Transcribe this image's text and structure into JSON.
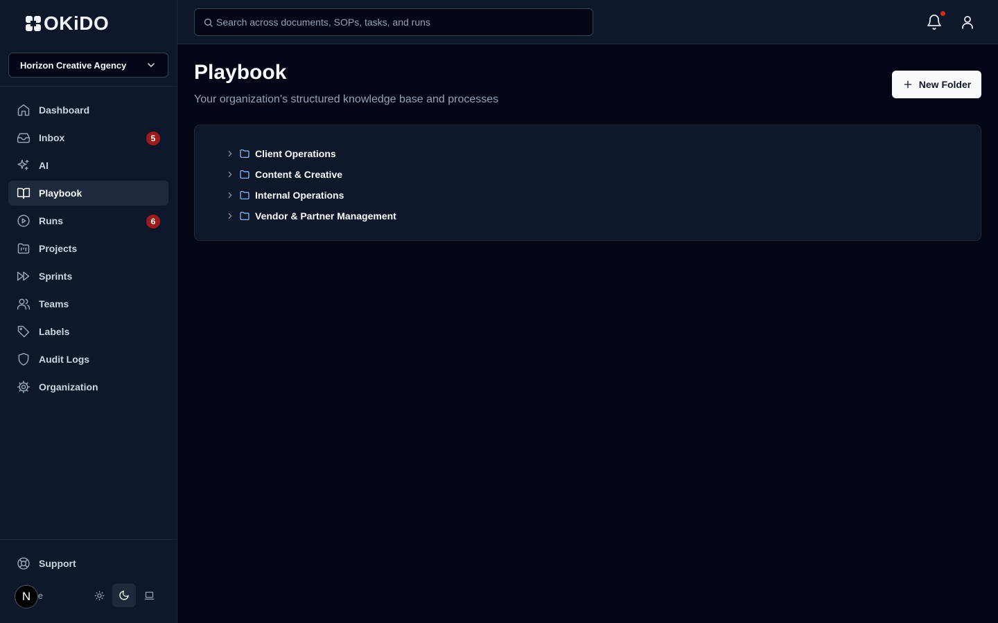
{
  "brand": {
    "name": "OKiDO"
  },
  "org_selector": {
    "value": "Horizon Creative Agency"
  },
  "nav": [
    {
      "label": "Dashboard",
      "icon": "home-icon",
      "active": false
    },
    {
      "label": "Inbox",
      "icon": "inbox-icon",
      "badge": "5",
      "active": false
    },
    {
      "label": "AI",
      "icon": "sparkles-icon",
      "active": false
    },
    {
      "label": "Playbook",
      "icon": "book-open-icon",
      "active": true
    },
    {
      "label": "Runs",
      "icon": "play-circle-icon",
      "badge": "6",
      "active": false
    },
    {
      "label": "Projects",
      "icon": "folder-kanban-icon",
      "active": false
    },
    {
      "label": "Sprints",
      "icon": "fast-forward-icon",
      "active": false
    },
    {
      "label": "Teams",
      "icon": "users-icon",
      "active": false
    },
    {
      "label": "Labels",
      "icon": "tag-icon",
      "active": false
    },
    {
      "label": "Audit Logs",
      "icon": "shield-icon",
      "active": false
    },
    {
      "label": "Organization",
      "icon": "gear-icon",
      "active": false
    }
  ],
  "footer": {
    "support_label": "Support",
    "avatar_initial": "N",
    "user_name_fragment": "e",
    "theme_active": "dark"
  },
  "search": {
    "placeholder": "Search across documents, SOPs, tasks, and runs",
    "value": ""
  },
  "page": {
    "title": "Playbook",
    "subtitle": "Your organization's structured knowledge base and processes",
    "new_folder_label": "New Folder"
  },
  "folders": [
    {
      "label": "Client Operations"
    },
    {
      "label": "Content & Creative"
    },
    {
      "label": "Internal Operations"
    },
    {
      "label": "Vendor & Partner Management"
    }
  ],
  "colors": {
    "background": "#020617",
    "sidebar": "#0f172a",
    "badge": "#991b1b",
    "notification_dot": "#dc2626",
    "folder_icon": "#93c5fd"
  }
}
